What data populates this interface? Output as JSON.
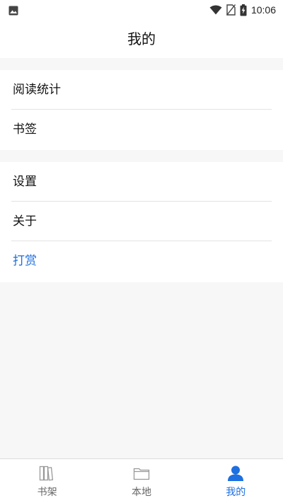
{
  "status_bar": {
    "time": "10:06",
    "icons": [
      "image-icon",
      "wifi-icon",
      "no-sim-icon",
      "battery-charging-icon"
    ]
  },
  "app_bar": {
    "title": "我的"
  },
  "groups": [
    {
      "items": [
        {
          "label": "阅读统计"
        },
        {
          "label": "书签"
        }
      ]
    },
    {
      "items": [
        {
          "label": "设置"
        },
        {
          "label": "关于"
        },
        {
          "label": "打赏"
        }
      ]
    }
  ],
  "bottom_nav": {
    "items": [
      {
        "label": "书架",
        "icon": "bookshelf-icon"
      },
      {
        "label": "本地",
        "icon": "folder-icon"
      },
      {
        "label": "我的",
        "icon": "person-icon",
        "active": true
      }
    ]
  },
  "colors": {
    "accent": "#1e6fe0",
    "background": "#f7f7f7",
    "surface": "#ffffff",
    "text": "#111111",
    "nav_inactive": "#666666"
  }
}
